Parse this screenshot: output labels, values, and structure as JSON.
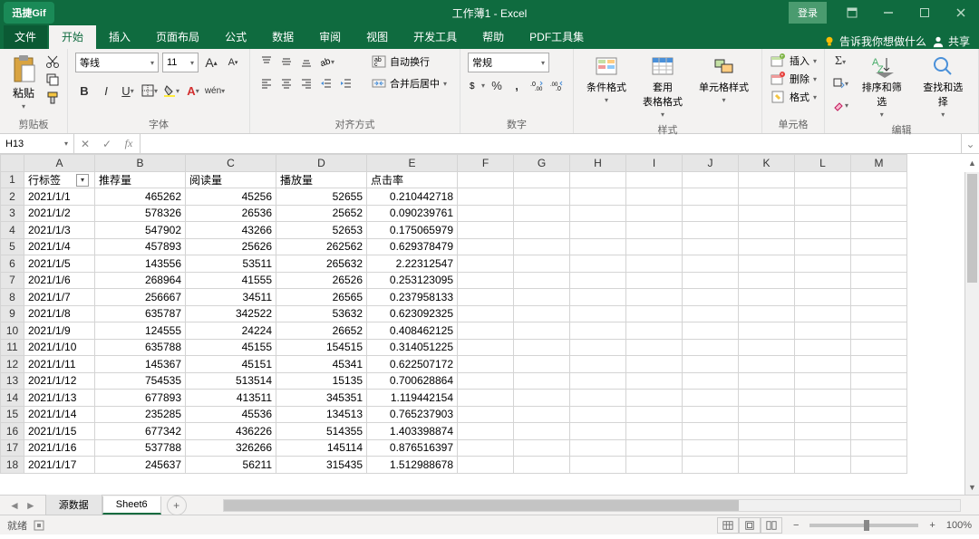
{
  "title": {
    "workbook": "工作薄1",
    "app": "Excel",
    "display": "工作薄1  -  Excel"
  },
  "logo": "迅捷Gif",
  "login_label": "登录",
  "file_tab": "文件",
  "tabs": [
    "开始",
    "插入",
    "页面布局",
    "公式",
    "数据",
    "审阅",
    "视图",
    "开发工具",
    "帮助",
    "PDF工具集"
  ],
  "active_tab": "开始",
  "tell_me": "告诉我你想做什么",
  "share": "共享",
  "ribbon": {
    "clipboard": {
      "paste": "粘贴",
      "label": "剪贴板"
    },
    "font": {
      "name": "等线",
      "size": "11",
      "label": "字体"
    },
    "alignment": {
      "wrap": "自动换行",
      "merge": "合并后居中",
      "label": "对齐方式"
    },
    "number": {
      "format": "常规",
      "label": "数字"
    },
    "styles": {
      "cond": "条件格式",
      "table": "套用\n表格格式",
      "cell": "单元格样式",
      "label": "样式"
    },
    "cells": {
      "insert": "插入",
      "delete": "删除",
      "format": "格式",
      "label": "单元格"
    },
    "editing": {
      "sort": "排序和筛选",
      "find": "查找和选择",
      "label": "编辑"
    }
  },
  "name_box": "H13",
  "formula": "",
  "columns": [
    "A",
    "B",
    "C",
    "D",
    "E",
    "F",
    "G",
    "H",
    "I",
    "J",
    "K",
    "L",
    "M"
  ],
  "headers": {
    "A": "行标签",
    "B": "推荐量",
    "C": "阅读量",
    "D": "播放量",
    "E": "点击率"
  },
  "rows": [
    {
      "n": 1,
      "A": "行标签",
      "B": "推荐量",
      "C": "阅读量",
      "D": "播放量",
      "E": "点击率",
      "is_header": true
    },
    {
      "n": 2,
      "A": "2021/1/1",
      "B": "465262",
      "C": "45256",
      "D": "52655",
      "E": "0.210442718"
    },
    {
      "n": 3,
      "A": "2021/1/2",
      "B": "578326",
      "C": "26536",
      "D": "25652",
      "E": "0.090239761"
    },
    {
      "n": 4,
      "A": "2021/1/3",
      "B": "547902",
      "C": "43266",
      "D": "52653",
      "E": "0.175065979"
    },
    {
      "n": 5,
      "A": "2021/1/4",
      "B": "457893",
      "C": "25626",
      "D": "262562",
      "E": "0.629378479"
    },
    {
      "n": 6,
      "A": "2021/1/5",
      "B": "143556",
      "C": "53511",
      "D": "265632",
      "E": "2.22312547"
    },
    {
      "n": 7,
      "A": "2021/1/6",
      "B": "268964",
      "C": "41555",
      "D": "26526",
      "E": "0.253123095"
    },
    {
      "n": 8,
      "A": "2021/1/7",
      "B": "256667",
      "C": "34511",
      "D": "26565",
      "E": "0.237958133"
    },
    {
      "n": 9,
      "A": "2021/1/8",
      "B": "635787",
      "C": "342522",
      "D": "53632",
      "E": "0.623092325"
    },
    {
      "n": 10,
      "A": "2021/1/9",
      "B": "124555",
      "C": "24224",
      "D": "26652",
      "E": "0.408462125"
    },
    {
      "n": 11,
      "A": "2021/1/10",
      "B": "635788",
      "C": "45155",
      "D": "154515",
      "E": "0.314051225"
    },
    {
      "n": 12,
      "A": "2021/1/11",
      "B": "145367",
      "C": "45151",
      "D": "45341",
      "E": "0.622507172"
    },
    {
      "n": 13,
      "A": "2021/1/12",
      "B": "754535",
      "C": "513514",
      "D": "15135",
      "E": "0.700628864"
    },
    {
      "n": 14,
      "A": "2021/1/13",
      "B": "677893",
      "C": "413511",
      "D": "345351",
      "E": "1.119442154"
    },
    {
      "n": 15,
      "A": "2021/1/14",
      "B": "235285",
      "C": "45536",
      "D": "134513",
      "E": "0.765237903"
    },
    {
      "n": 16,
      "A": "2021/1/15",
      "B": "677342",
      "C": "436226",
      "D": "514355",
      "E": "1.403398874"
    },
    {
      "n": 17,
      "A": "2021/1/16",
      "B": "537788",
      "C": "326266",
      "D": "145114",
      "E": "0.876516397"
    },
    {
      "n": 18,
      "A": "2021/1/17",
      "B": "245637",
      "C": "56211",
      "D": "315435",
      "E": "1.512988678"
    }
  ],
  "sheets": {
    "list": [
      "源数据",
      "Sheet6"
    ],
    "active": "Sheet6"
  },
  "status": {
    "ready": "就绪",
    "zoom": "100%"
  }
}
